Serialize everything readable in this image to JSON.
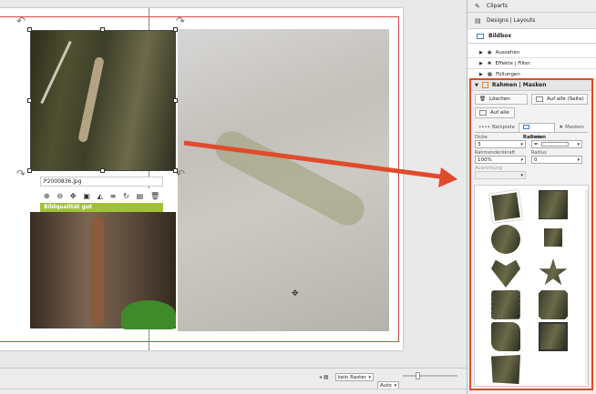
{
  "canvas": {
    "photo1_filename": "P2000836.jpg",
    "quality_label": "Bildqualität gut",
    "toolbar_icons": [
      "zoom-in-icon",
      "zoom-out-icon",
      "move-icon",
      "crop-icon",
      "flip-icon",
      "align-icon",
      "rotate-icon",
      "arrange-icon",
      "delete-icon"
    ],
    "toolbar_glyphs": [
      "⊕",
      "⊖",
      "✥",
      "▣",
      "◭",
      "≡",
      "↻",
      "▤",
      "🗑"
    ]
  },
  "statusbar": {
    "raster_label": "kein Raster",
    "zoom_label": "Auto"
  },
  "panel": {
    "cliparts": "Cliparts",
    "designs": "Designs | Layouts",
    "bildbox": "Bildbox",
    "aussehen": "Aussehen",
    "effekte": "Effekte | Filter",
    "fuellungen": "Füllungen",
    "rahmen_masken": "Rahmen | Masken",
    "loeschen": "Löschen",
    "auf_alle_seite": "Auf alle (Seite)",
    "auf_alle": "Auf alle",
    "tabs": [
      "Beispiele",
      "Rahmen",
      "Masken"
    ],
    "dicke_label": "Dicke",
    "dicke_value": "3",
    "farbe_label": "Farbe",
    "deckkraft_label": "Rahmendeckkraft",
    "deckkraft_value": "100%",
    "radius_label": "Radius",
    "radius_value": "0",
    "ausrichtung_label": "Ausrichtung"
  },
  "colors": {
    "highlight": "#e04b2b",
    "quality": "#9fc13a",
    "guide": "#dd4444"
  }
}
